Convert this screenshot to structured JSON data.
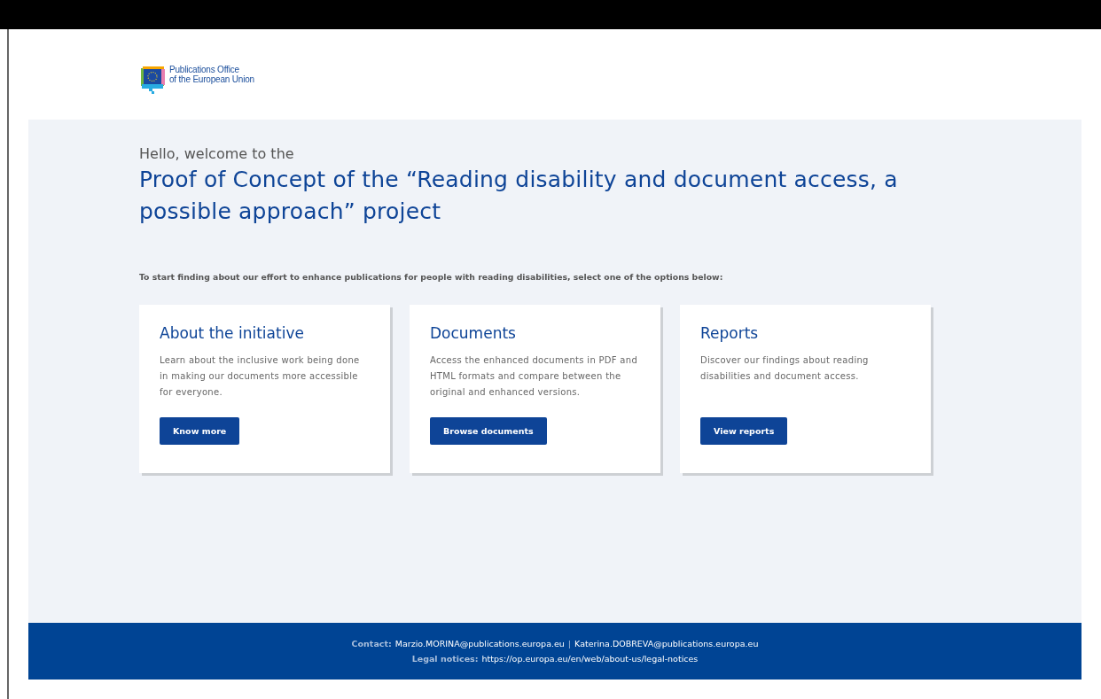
{
  "logo": {
    "lines": [
      "Publications Office",
      "of the European Union"
    ]
  },
  "hero": {
    "greeting": "Hello, welcome to the",
    "title": "Proof of Concept of the “Reading disability and document access, a possible approach” project",
    "intro": "To start finding about our effort to enhance publications for people with reading disabilities, select one of the options below:"
  },
  "cards": [
    {
      "title": "About the initiative",
      "text": "Learn about the inclusive work being done in making our documents more accessible for everyone.",
      "button": "Know more"
    },
    {
      "title": "Documents",
      "text": "Access the enhanced documents in PDF and HTML formats and compare between the original and enhanced versions.",
      "button": "Browse documents"
    },
    {
      "title": "Reports",
      "text": "Discover our findings about reading disabilities and document access.",
      "button": "View reports"
    }
  ],
  "footer": {
    "contact_label": "Contact:",
    "contacts": [
      "Marzio.MORINA@publications.europa.eu",
      "Katerina.DOBREVA@publications.europa.eu"
    ],
    "separator": "|",
    "legal_label": "Legal notices:",
    "legal_link": "https://op.europa.eu/en/web/about-us/legal-notices"
  }
}
